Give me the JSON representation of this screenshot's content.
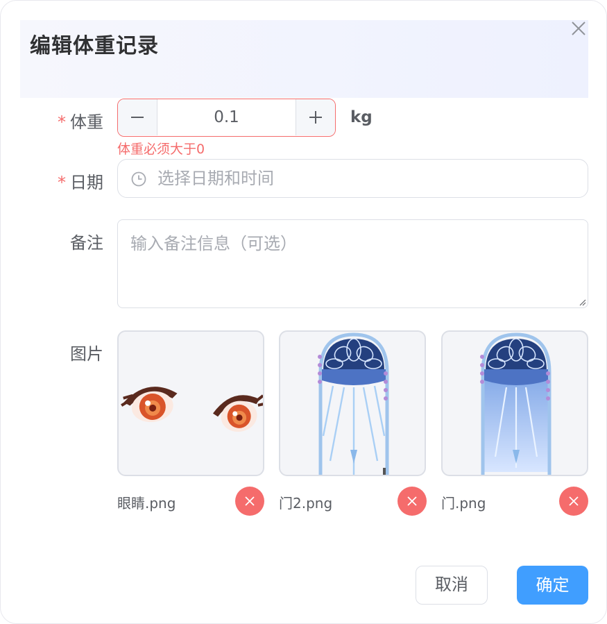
{
  "dialog": {
    "title": "编辑体重记录",
    "close_icon": "close-icon"
  },
  "form": {
    "weight": {
      "required_mark": "*",
      "label": "体重",
      "value": "0.1",
      "unit": "kg",
      "error": "体重必须大于0",
      "decrement_icon": "minus-icon",
      "increment_icon": "plus-icon"
    },
    "date": {
      "required_mark": "*",
      "label": "日期",
      "placeholder": "选择日期和时间",
      "icon": "clock-icon"
    },
    "note": {
      "label": "备注",
      "placeholder": "输入备注信息（可选）"
    },
    "images": {
      "label": "图片",
      "files": [
        {
          "name": "眼睛.png"
        },
        {
          "name": "门2.png"
        },
        {
          "name": "门.png"
        }
      ],
      "delete_icon": "close-icon"
    }
  },
  "footer": {
    "cancel_label": "取消",
    "confirm_label": "确定"
  },
  "colors": {
    "primary": "#409eff",
    "danger": "#f56c6c",
    "header_bg": "#eef1fe"
  }
}
